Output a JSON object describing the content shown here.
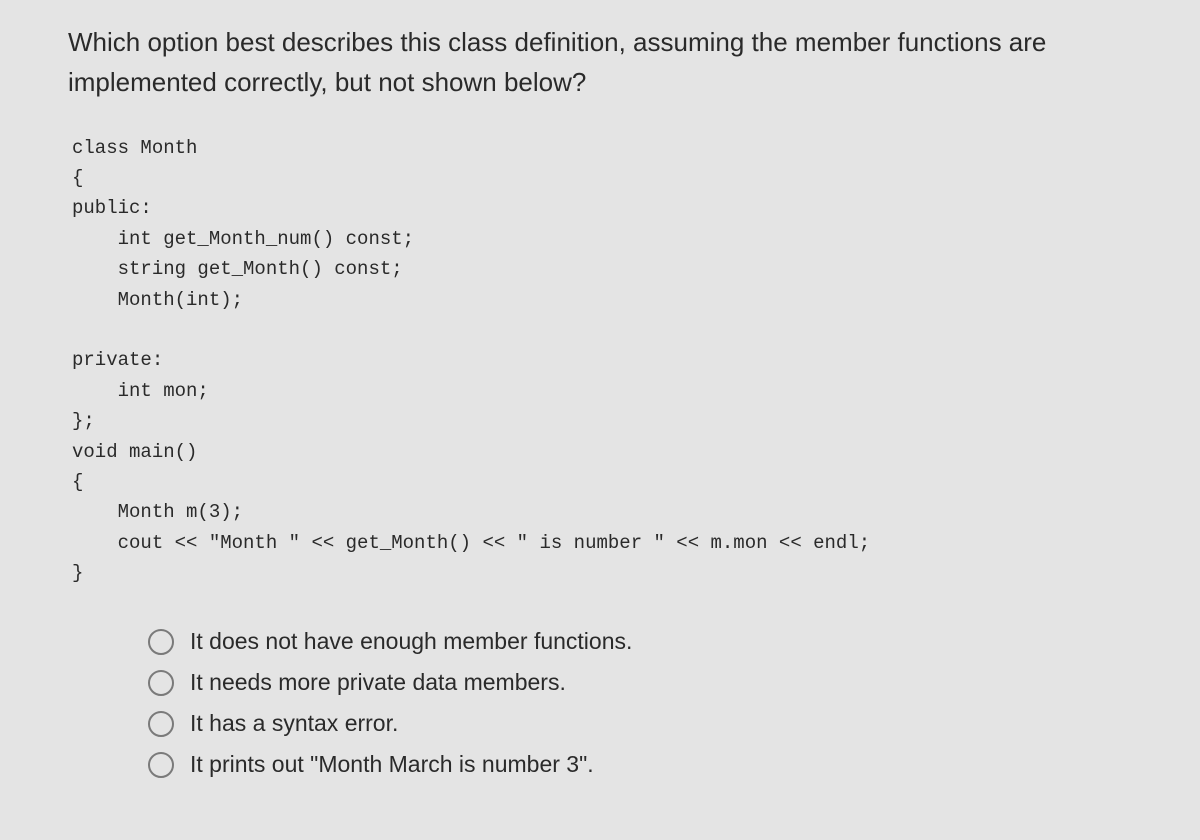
{
  "question": "Which option best describes this class definition, assuming the member functions are implemented correctly, but not shown below?",
  "code": "class Month\n{\npublic:\n    int get_Month_num() const;\n    string get_Month() const;\n    Month(int);\n\nprivate:\n    int mon;\n};\nvoid main()\n{\n    Month m(3);\n    cout << \"Month \" << get_Month() << \" is number \" << m.mon << endl;\n}",
  "options": [
    {
      "label": "It does not have enough member functions."
    },
    {
      "label": "It needs more private data members."
    },
    {
      "label": "It has a syntax error."
    },
    {
      "label": "It prints out \"Month March is number 3\"."
    }
  ]
}
